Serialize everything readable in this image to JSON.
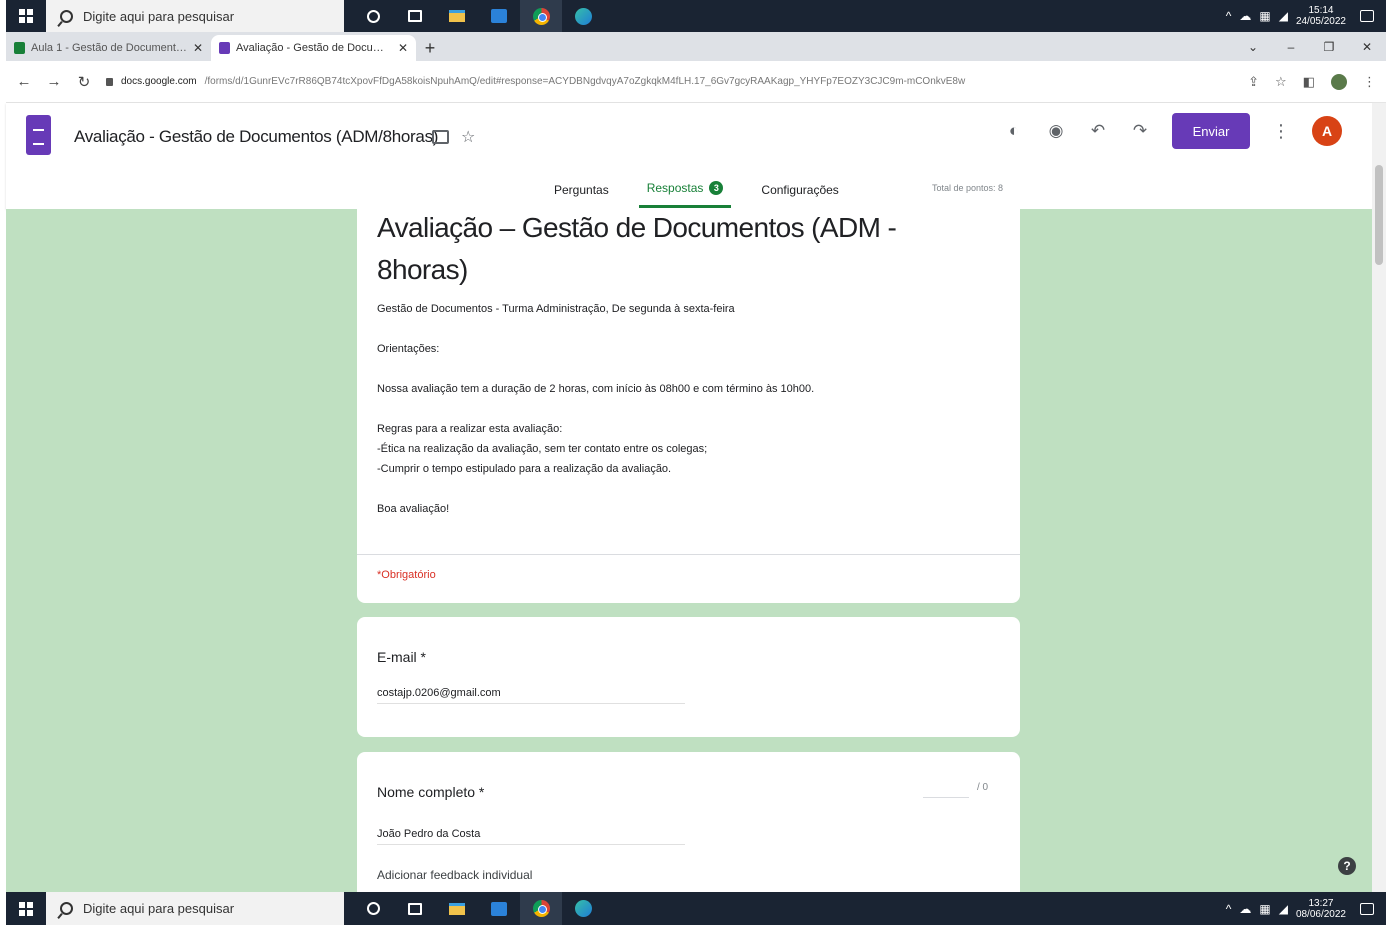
{
  "taskbar_top": {
    "search_placeholder": "Digite aqui para pesquisar",
    "time": "15:14",
    "date": "24/05/2022"
  },
  "tabs": [
    {
      "title": "Aula 1 - Gestão de Documentos"
    },
    {
      "title": "Avaliação - Gestão de Documen"
    }
  ],
  "address": {
    "host": "docs.google.com",
    "path": "/forms/d/1GunrEVc7rR86QB74tcXpovFfDgA58koisNpuhAmQ/edit#response=ACYDBNgdvqyA7oZgkqkM4fLH.17_6Gv7gcyRAAKagp_YHYFp7EOZY3CJC9m-mCOnkvE8w"
  },
  "form_header": {
    "doc_title": "Avaliação - Gestão de Documentos (ADM/8horas)",
    "send_label": "Enviar",
    "avatar_letter": "A",
    "tabs": {
      "questions": "Perguntas",
      "responses": "Respostas",
      "responses_count": "3",
      "settings": "Configurações"
    },
    "points_total": "Total de pontos: 8"
  },
  "form": {
    "title": "Avaliação – Gestão de Documentos (ADM - 8horas)",
    "description": {
      "line1": "Gestão de Documentos - Turma Administração, De segunda à sexta-feira",
      "line2": "Orientações:",
      "line3": "Nossa avaliação tem a duração de  2 horas, com início às 08h00 e com término às 10h00.",
      "line4": "Regras para a realizar esta avaliação:",
      "line5": "-Ética na realização da avaliação, sem ter contato entre os colegas;",
      "line6": "-Cumprir o tempo estipulado para a realização da avaliação.",
      "line7": "Boa avaliação!"
    },
    "required_note": "*Obrigatório"
  },
  "questions": {
    "email": {
      "label": "E-mail *",
      "answer": "costajp.0206@gmail.com"
    },
    "name": {
      "label": "Nome completo *",
      "answer": "João Pedro da Costa",
      "score_total": "/ 0",
      "feedback_link": "Adicionar feedback individual"
    }
  },
  "taskbar_bottom": {
    "search_placeholder": "Digite aqui para pesquisar",
    "time": "13:27",
    "date": "08/06/2022"
  },
  "colors": {
    "accent": "#673ab7",
    "responses_green": "#188038",
    "background_green": "#bfe0c1",
    "required_red": "#d93025"
  }
}
